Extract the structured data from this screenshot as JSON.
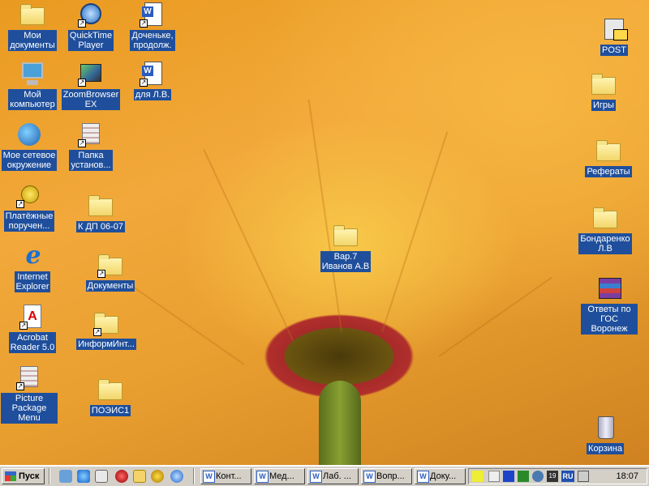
{
  "desktop": {
    "icons": [
      {
        "id": "my-documents",
        "label": "Мои\nдокументы",
        "type": "folder"
      },
      {
        "id": "quicktime",
        "label": "QuickTime\nPlayer",
        "type": "qt"
      },
      {
        "id": "doc-dochenke",
        "label": "Доченьке,\nпродолж.",
        "type": "doc"
      },
      {
        "id": "my-computer",
        "label": "Мой\nкомпьютер",
        "type": "monitor"
      },
      {
        "id": "zoombrowser",
        "label": "ZoomBrowser\nEX",
        "type": "zoom"
      },
      {
        "id": "doc-lv",
        "label": "для Л.В.",
        "type": "doc"
      },
      {
        "id": "network",
        "label": "Мое сетевое\nокружение",
        "type": "globe"
      },
      {
        "id": "install-folder",
        "label": "Папка\nустанов...",
        "type": "pkg"
      },
      {
        "id": "payments",
        "label": "Платёжные\nпоручен...",
        "type": "coins"
      },
      {
        "id": "folder-kdp",
        "label": "К ДП 06-07",
        "type": "folder"
      },
      {
        "id": "ie",
        "label": "Internet\nExplorer",
        "type": "ie"
      },
      {
        "id": "documents",
        "label": "Документы",
        "type": "folder"
      },
      {
        "id": "acrobat",
        "label": "Acrobat\nReader 5.0",
        "type": "acro"
      },
      {
        "id": "inform",
        "label": "ИнформИнт...",
        "type": "folder"
      },
      {
        "id": "picture-package",
        "label": "Picture\nPackage Menu",
        "type": "pkg"
      },
      {
        "id": "poeis",
        "label": "ПОЭИС1",
        "type": "folder"
      },
      {
        "id": "var7",
        "label": "Вар.7\nИванов А.В",
        "type": "folder"
      },
      {
        "id": "post",
        "label": "POST",
        "type": "post"
      },
      {
        "id": "games",
        "label": "Игры",
        "type": "folder"
      },
      {
        "id": "referaty",
        "label": "Рефераты",
        "type": "folder"
      },
      {
        "id": "bondarenko",
        "label": "Бондаренко\nЛ.В",
        "type": "folder"
      },
      {
        "id": "answers",
        "label": "Ответы по\nГОС Воронеж",
        "type": "rar"
      },
      {
        "id": "recycle",
        "label": "Корзина",
        "type": "trash"
      }
    ]
  },
  "taskbar": {
    "start_label": "Пуск",
    "buttons": [
      "Конт...",
      "Мед...",
      "Лаб. ...",
      "Вопр...",
      "Доку..."
    ],
    "language": "RU",
    "clock": "18:07"
  }
}
